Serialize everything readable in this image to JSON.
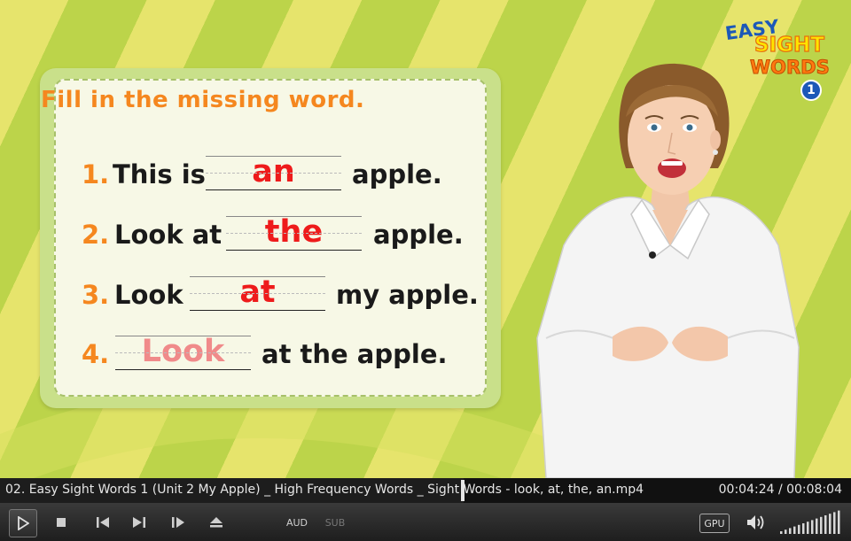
{
  "lesson": {
    "instruction": "Fill in the missing word.",
    "questions": [
      {
        "number": "1.",
        "before": "This is",
        "answer": "an",
        "after": "apple."
      },
      {
        "number": "2.",
        "before": "Look at",
        "answer": "the",
        "after": "apple."
      },
      {
        "number": "3.",
        "before": "Look",
        "answer": "at",
        "after": "my apple."
      },
      {
        "number": "4.",
        "before": "",
        "answer": "Look",
        "after": "at the apple."
      }
    ]
  },
  "logo": {
    "line1": "EASY",
    "line2": "SIGHT",
    "line3": "WORDS",
    "badge": "1"
  },
  "player": {
    "file_title": "02. Easy Sight Words 1 (Unit 2 My Apple)  _ High Frequency Words _ Sight Words  - look, at, the, an.mp4",
    "time": "00:04:24 / 00:08:04",
    "progress": 0.545,
    "aud_label": "AUD",
    "sub_label": "SUB",
    "gpu_label": "GPU",
    "volume_level": 1.0
  },
  "colors": {
    "accent": "#f5871f",
    "answer": "#ee1b1b",
    "answer_faded": "#f08a8a"
  }
}
